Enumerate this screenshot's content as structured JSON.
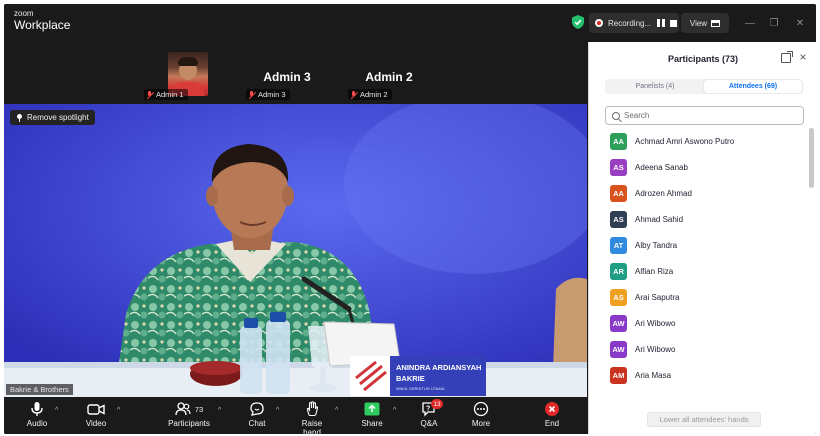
{
  "app": {
    "brand_top": "zoom",
    "brand_bottom": "Workplace"
  },
  "titlebar": {
    "recording_label": "Recording...",
    "view_label": "View",
    "minimize": "—",
    "restore": "❐",
    "close": "✕"
  },
  "thumbnails": [
    {
      "label": "Admin 1",
      "has_video": true,
      "display_name": ""
    },
    {
      "label": "Admin 3",
      "has_video": false,
      "display_name": "Admin 3"
    },
    {
      "label": "Admin 2",
      "has_video": false,
      "display_name": "Admin 2"
    }
  ],
  "video": {
    "spotlight_button": "Remove spotlight",
    "participant_name": "Bakrie & Brothers",
    "name_plate_line1": "ANINDRA ARDIANSYAH",
    "name_plate_line2": "BAKRIE",
    "name_plate_line3": "WAKIL DIREKTUR UTAMA"
  },
  "toolbar": {
    "audio": "Audio",
    "video": "Video",
    "participants": "Participants",
    "participant_count": "73",
    "chat": "Chat",
    "raise_hand": "Raise hand",
    "share": "Share",
    "qa": "Q&A",
    "qa_badge": "13",
    "more": "More",
    "end": "End",
    "caret": "^"
  },
  "panel": {
    "title": "Participants (73)",
    "tabs": {
      "panelists": "Panelists (4)",
      "attendees": "Attendees (69)"
    },
    "search_placeholder": "Search",
    "lower_hands_button": "Lower all attendees' hands",
    "attendees": [
      {
        "initials": "AA",
        "name": "Achmad Amri Aswono Putro",
        "color": "#2e9e5b"
      },
      {
        "initials": "AS",
        "name": "Adeena Sanab",
        "color": "#9b3fc2"
      },
      {
        "initials": "AA",
        "name": "Adrozen Ahmad",
        "color": "#d9531e"
      },
      {
        "initials": "AS",
        "name": "Ahmad Sahid",
        "color": "#2f3e53"
      },
      {
        "initials": "AT",
        "name": "Alby Tandra",
        "color": "#2f8ae0"
      },
      {
        "initials": "AR",
        "name": "Alfian Riza",
        "color": "#1f9e84"
      },
      {
        "initials": "AS",
        "name": "Arai Saputra",
        "color": "#f0a020"
      },
      {
        "initials": "AW",
        "name": "Ari Wibowo",
        "color": "#8a3ac8"
      },
      {
        "initials": "AW",
        "name": "Ari Wibowo",
        "color": "#8a3ac8"
      },
      {
        "initials": "AM",
        "name": "Aria Masa",
        "color": "#c9331f"
      }
    ]
  },
  "colors": {
    "video_bg": "#3a42d6",
    "accent_blue": "#0e72ed",
    "share_green": "#2ecc5e",
    "end_red": "#e02828",
    "shield_green": "#23c16b"
  }
}
